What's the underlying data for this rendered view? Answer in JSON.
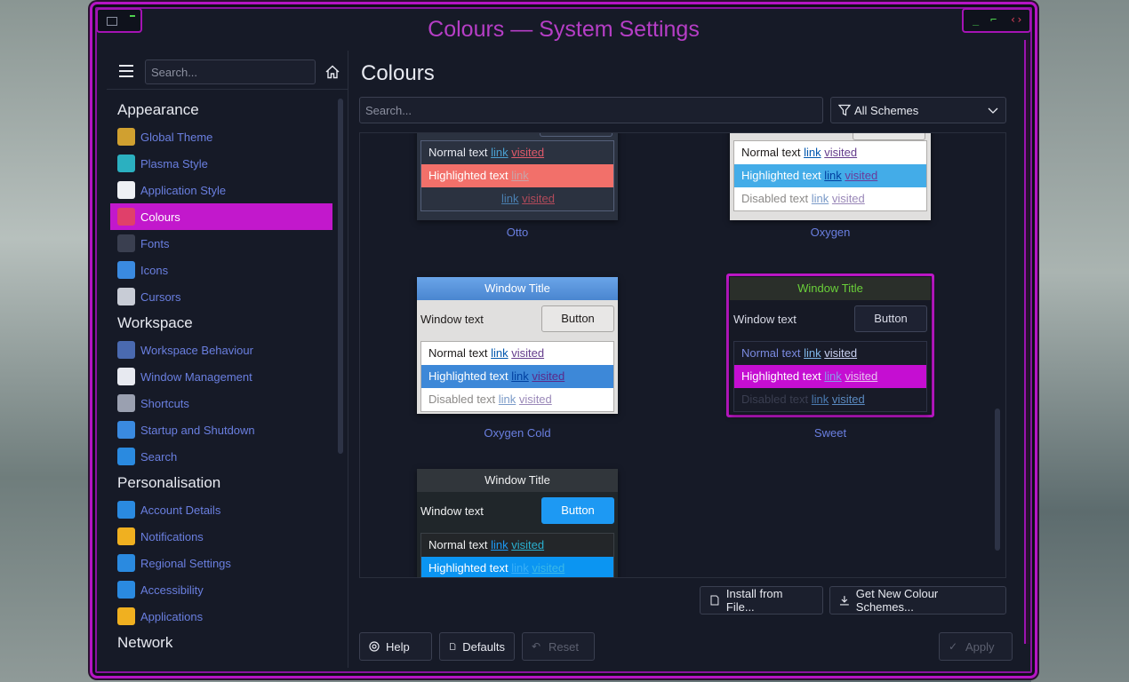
{
  "window": {
    "title": "Colours — System Settings"
  },
  "sidebar": {
    "search_placeholder": "Search...",
    "sections": [
      {
        "title": "Appearance",
        "items": [
          {
            "label": "Global Theme",
            "icon": "global-theme-icon",
            "color": "#d0a030"
          },
          {
            "label": "Plasma Style",
            "icon": "plasma-style-icon",
            "color": "#2bb0c0"
          },
          {
            "label": "Application Style",
            "icon": "application-style-icon",
            "color": "#eef0f4"
          },
          {
            "label": "Colours",
            "icon": "colours-icon",
            "color": "#e0406a",
            "active": true
          },
          {
            "label": "Fonts",
            "icon": "fonts-icon",
            "color": "#3a3f50"
          },
          {
            "label": "Icons",
            "icon": "icons-icon",
            "color": "#3a8ae0"
          },
          {
            "label": "Cursors",
            "icon": "cursors-icon",
            "color": "#c8ccd6"
          }
        ]
      },
      {
        "title": "Workspace",
        "items": [
          {
            "label": "Workspace Behaviour",
            "icon": "workspace-behaviour-icon",
            "color": "#4a6ab0"
          },
          {
            "label": "Window Management",
            "icon": "window-management-icon",
            "color": "#e7e9f0"
          },
          {
            "label": "Shortcuts",
            "icon": "shortcuts-icon",
            "color": "#9aa0b0"
          },
          {
            "label": "Startup and Shutdown",
            "icon": "startup-shutdown-icon",
            "color": "#3a8ae0"
          },
          {
            "label": "Search",
            "icon": "search-icon",
            "color": "#2a8ae0"
          }
        ]
      },
      {
        "title": "Personalisation",
        "items": [
          {
            "label": "Account Details",
            "icon": "account-details-icon",
            "color": "#2a8ae0"
          },
          {
            "label": "Notifications",
            "icon": "notifications-icon",
            "color": "#f0b020"
          },
          {
            "label": "Regional Settings",
            "icon": "regional-settings-icon",
            "color": "#2a8ae0"
          },
          {
            "label": "Accessibility",
            "icon": "accessibility-icon",
            "color": "#2a8ae0"
          },
          {
            "label": "Applications",
            "icon": "applications-icon",
            "color": "#f0b020"
          }
        ]
      },
      {
        "title": "Network",
        "items": []
      }
    ]
  },
  "main": {
    "page_title": "Colours",
    "search_placeholder": "Search...",
    "filter_label": "All Schemes",
    "schemes": {
      "otto": {
        "name": "Otto",
        "normal": "Normal text",
        "highlighted": "Highlighted text",
        "link": "link",
        "visited": "visited"
      },
      "oxygen": {
        "name": "Oxygen",
        "normal": "Normal text",
        "highlighted": "Highlighted text",
        "disabled": "Disabled text",
        "link": "link",
        "visited": "visited"
      },
      "oxygen_cold": {
        "name": "Oxygen Cold",
        "window_title": "Window Title",
        "window_text": "Window text",
        "button": "Button",
        "normal": "Normal text",
        "highlighted": "Highlighted text",
        "disabled": "Disabled text",
        "link": "link",
        "visited": "visited"
      },
      "sweet": {
        "name": "Sweet",
        "window_title": "Window Title",
        "window_text": "Window text",
        "button": "Button",
        "normal": "Normal text",
        "highlighted": "Highlighted text",
        "disabled": "Disabled text",
        "link": "link",
        "visited": "visited"
      },
      "breeze_dark": {
        "window_title": "Window Title",
        "window_text": "Window text",
        "button": "Button",
        "normal": "Normal text",
        "highlighted": "Highlighted text",
        "link": "link",
        "visited": "visited"
      }
    },
    "install_button": "Install from File...",
    "get_new_button": "Get New Colour Schemes..."
  },
  "footer": {
    "help": "Help",
    "defaults": "Defaults",
    "reset": "Reset",
    "apply": "Apply"
  },
  "colors": {
    "accent": "#c218cc",
    "link": "#6a7fe0",
    "window_bg": "#161a27"
  }
}
